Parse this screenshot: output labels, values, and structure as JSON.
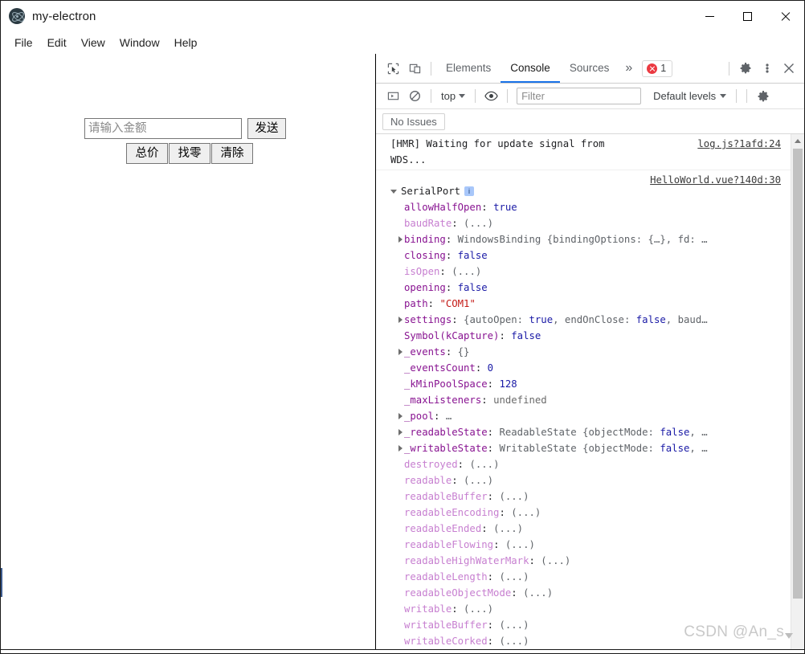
{
  "window": {
    "title": "my-electron",
    "app_icon": "electron-atom-icon",
    "controls": {
      "minimize": "minimize-icon",
      "maximize": "maximize-icon",
      "close": "close-icon"
    }
  },
  "menubar": {
    "items": [
      {
        "label": "File"
      },
      {
        "label": "Edit"
      },
      {
        "label": "View"
      },
      {
        "label": "Window"
      },
      {
        "label": "Help"
      }
    ]
  },
  "renderer": {
    "amount_input": {
      "value": "",
      "placeholder": "请输入金额"
    },
    "send_button": "发送",
    "action_buttons": [
      {
        "label": "总价"
      },
      {
        "label": "找零"
      },
      {
        "label": "清除"
      }
    ]
  },
  "devtools": {
    "toolbar": {
      "inspect_icon": "inspect-element-icon",
      "device_icon": "device-toolbar-icon",
      "tabs": [
        {
          "label": "Elements",
          "active": false
        },
        {
          "label": "Console",
          "active": true
        },
        {
          "label": "Sources",
          "active": false
        }
      ],
      "more_tabs": "»",
      "error_count": "1",
      "settings_icon": "gear-icon",
      "menu_icon": "kebab-menu-icon",
      "close_icon": "close-devtools-icon"
    },
    "filterbar": {
      "sidebar_toggle_icon": "console-sidebar-icon",
      "clear_icon": "clear-console-icon",
      "context": "top",
      "eye_icon": "live-expression-eye-icon",
      "filter_placeholder": "Filter",
      "filter_value": "",
      "levels": "Default levels",
      "settings_icon": "console-settings-gear-icon"
    },
    "issues_button": "No Issues",
    "console": {
      "messages": [
        {
          "text": "[HMR] Waiting for update signal from WDS...",
          "source": "log.js?1afd:24"
        }
      ],
      "object_log": {
        "source": "HelloWorld.vue?140d:30",
        "name": "SerialPort",
        "badge": "i",
        "properties": [
          {
            "indent": 1,
            "arrow": false,
            "key": "allowHalfOpen",
            "getter": false,
            "value": "true",
            "vtype": "bool"
          },
          {
            "indent": 1,
            "arrow": false,
            "key": "baudRate",
            "getter": true,
            "value": "(...)",
            "vtype": "dim"
          },
          {
            "indent": 1,
            "arrow": true,
            "key": "binding",
            "getter": false,
            "value": "WindowsBinding {bindingOptions: {…}, fd: …",
            "vtype": "obj"
          },
          {
            "indent": 1,
            "arrow": false,
            "key": "closing",
            "getter": false,
            "value": "false",
            "vtype": "bool"
          },
          {
            "indent": 1,
            "arrow": false,
            "key": "isOpen",
            "getter": true,
            "value": "(...)",
            "vtype": "dim"
          },
          {
            "indent": 1,
            "arrow": false,
            "key": "opening",
            "getter": false,
            "value": "false",
            "vtype": "bool"
          },
          {
            "indent": 1,
            "arrow": false,
            "key": "path",
            "getter": false,
            "value": "\"COM1\"",
            "vtype": "str"
          },
          {
            "indent": 1,
            "arrow": true,
            "key": "settings",
            "getter": false,
            "value": "{autoOpen: true, endOnClose: false, baud…",
            "vtype": "mixed"
          },
          {
            "indent": 1,
            "arrow": false,
            "key": "Symbol(kCapture)",
            "getter": false,
            "value": "false",
            "vtype": "bool"
          },
          {
            "indent": 1,
            "arrow": true,
            "key": "_events",
            "getter": false,
            "value": "{}",
            "vtype": "obj"
          },
          {
            "indent": 1,
            "arrow": false,
            "key": "_eventsCount",
            "getter": false,
            "value": "0",
            "vtype": "num"
          },
          {
            "indent": 1,
            "arrow": false,
            "key": "_kMinPoolSpace",
            "getter": false,
            "value": "128",
            "vtype": "num"
          },
          {
            "indent": 1,
            "arrow": false,
            "key": "_maxListeners",
            "getter": false,
            "value": "undefined",
            "vtype": "undef"
          },
          {
            "indent": 1,
            "arrow": true,
            "key": "_pool",
            "getter": false,
            "value": "…",
            "vtype": "obj"
          },
          {
            "indent": 1,
            "arrow": true,
            "key": "_readableState",
            "getter": false,
            "value": "ReadableState {objectMode: false, …",
            "vtype": "mixed"
          },
          {
            "indent": 1,
            "arrow": true,
            "key": "_writableState",
            "getter": false,
            "value": "WritableState {objectMode: false, …",
            "vtype": "mixed"
          },
          {
            "indent": 1,
            "arrow": false,
            "key": "destroyed",
            "getter": true,
            "value": "(...)",
            "vtype": "dim"
          },
          {
            "indent": 1,
            "arrow": false,
            "key": "readable",
            "getter": true,
            "value": "(...)",
            "vtype": "dim"
          },
          {
            "indent": 1,
            "arrow": false,
            "key": "readableBuffer",
            "getter": true,
            "value": "(...)",
            "vtype": "dim"
          },
          {
            "indent": 1,
            "arrow": false,
            "key": "readableEncoding",
            "getter": true,
            "value": "(...)",
            "vtype": "dim"
          },
          {
            "indent": 1,
            "arrow": false,
            "key": "readableEnded",
            "getter": true,
            "value": "(...)",
            "vtype": "dim"
          },
          {
            "indent": 1,
            "arrow": false,
            "key": "readableFlowing",
            "getter": true,
            "value": "(...)",
            "vtype": "dim"
          },
          {
            "indent": 1,
            "arrow": false,
            "key": "readableHighWaterMark",
            "getter": true,
            "value": "(...)",
            "vtype": "dim"
          },
          {
            "indent": 1,
            "arrow": false,
            "key": "readableLength",
            "getter": true,
            "value": "(...)",
            "vtype": "dim"
          },
          {
            "indent": 1,
            "arrow": false,
            "key": "readableObjectMode",
            "getter": true,
            "value": "(...)",
            "vtype": "dim"
          },
          {
            "indent": 1,
            "arrow": false,
            "key": "writable",
            "getter": true,
            "value": "(...)",
            "vtype": "dim"
          },
          {
            "indent": 1,
            "arrow": false,
            "key": "writableBuffer",
            "getter": true,
            "value": "(...)",
            "vtype": "dim"
          },
          {
            "indent": 1,
            "arrow": false,
            "key": "writableCorked",
            "getter": true,
            "value": "(...)",
            "vtype": "dim"
          }
        ]
      }
    }
  },
  "watermark": "CSDN @An_s",
  "colors": {
    "accent": "#1a73e8",
    "error": "#eb3941",
    "key": "#881391",
    "getter_key": "#c77fd0",
    "string": "#c41a16",
    "number": "#1a1aa6"
  }
}
